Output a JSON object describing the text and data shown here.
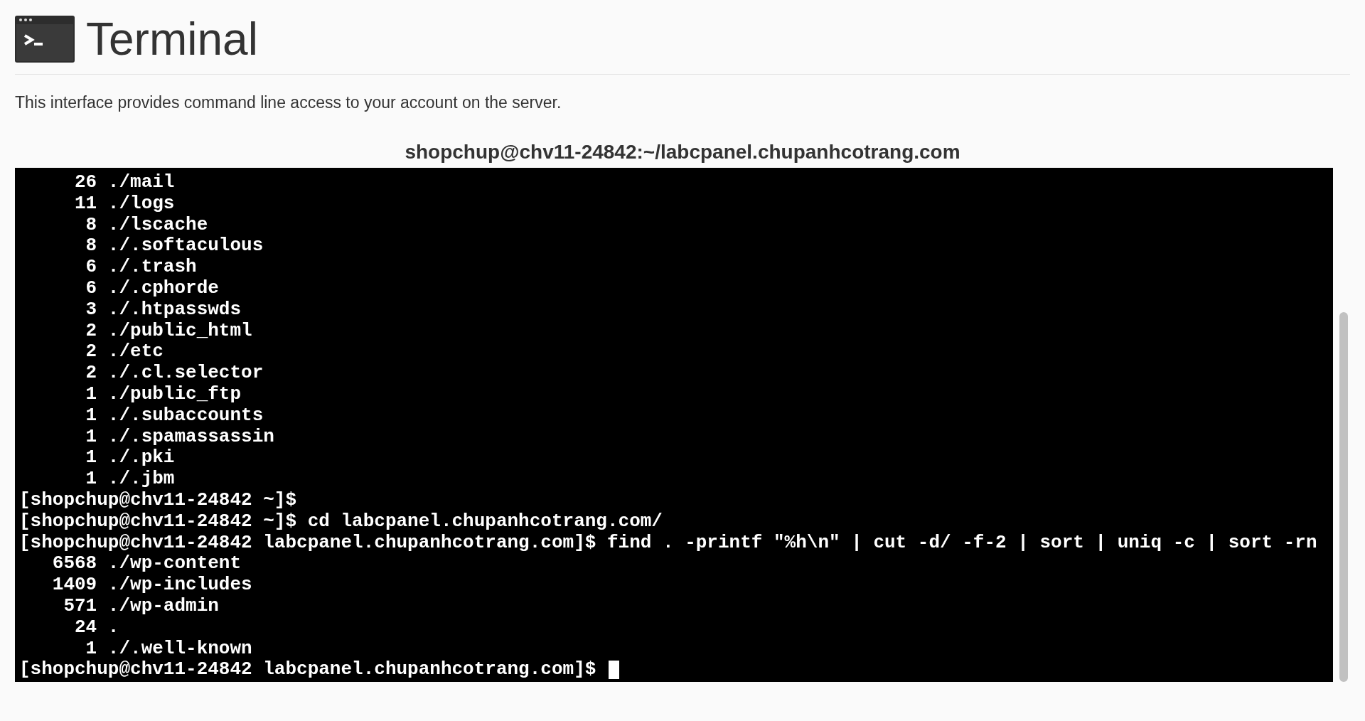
{
  "header": {
    "title": "Terminal"
  },
  "description": "This interface provides command line access to your account on the server.",
  "terminal": {
    "title": "shopchup@chv11-24842:~/labcpanel.chupanhcotrang.com",
    "lines": [
      "     26 ./mail",
      "     11 ./logs",
      "      8 ./lscache",
      "      8 ./.softaculous",
      "      6 ./.trash",
      "      6 ./.cphorde",
      "      3 ./.htpasswds",
      "      2 ./public_html",
      "      2 ./etc",
      "      2 ./.cl.selector",
      "      1 ./public_ftp",
      "      1 ./.subaccounts",
      "      1 ./.spamassassin",
      "      1 ./.pki",
      "      1 ./.jbm",
      "[shopchup@chv11-24842 ~]$",
      "[shopchup@chv11-24842 ~]$ cd labcpanel.chupanhcotrang.com/",
      "[shopchup@chv11-24842 labcpanel.chupanhcotrang.com]$ find . -printf \"%h\\n\" | cut -d/ -f-2 | sort | uniq -c | sort -rn",
      "   6568 ./wp-content",
      "   1409 ./wp-includes",
      "    571 ./wp-admin",
      "     24 .",
      "      1 ./.well-known",
      "[shopchup@chv11-24842 labcpanel.chupanhcotrang.com]$ "
    ],
    "cursor": true
  }
}
